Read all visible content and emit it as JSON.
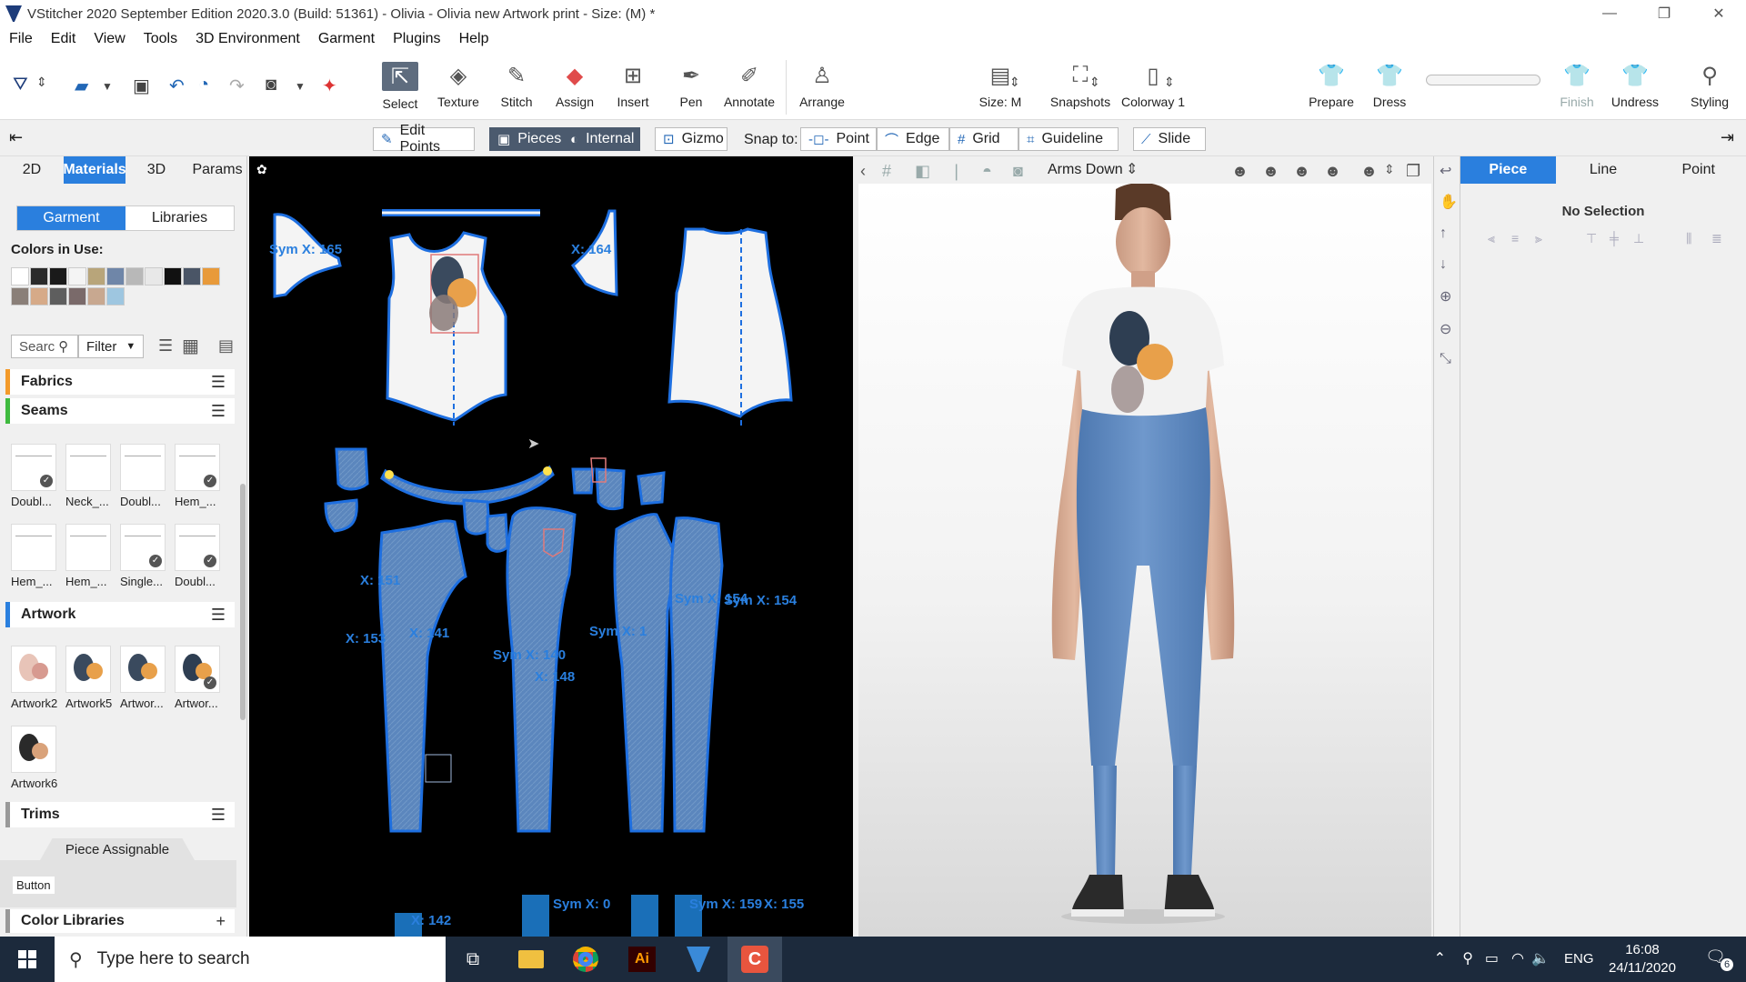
{
  "window": {
    "title": "VStitcher 2020 September Edition 2020.3.0 (Build: 51361) - Olivia - Olivia new Artwork print - Size: (M) *"
  },
  "menu": [
    "File",
    "Edit",
    "View",
    "Tools",
    "3D Environment",
    "Garment",
    "Plugins",
    "Help"
  ],
  "toolbar": {
    "select": "Select",
    "texture": "Texture",
    "stitch": "Stitch",
    "assign": "Assign",
    "insert": "Insert",
    "pen": "Pen",
    "annotate": "Annotate",
    "arrange": "Arrange",
    "size": "Size: M",
    "snapshots": "Snapshots",
    "colorway": "Colorway 1",
    "prepare": "Prepare",
    "dress": "Dress",
    "finish": "Finish",
    "undress": "Undress",
    "styling": "Styling"
  },
  "snapbar": {
    "edit_points": "Edit Points",
    "pieces": "Pieces",
    "internal": "Internal",
    "gizmo": "Gizmo",
    "snap_to": "Snap to:",
    "point": "Point",
    "edge": "Edge",
    "grid": "Grid",
    "guideline": "Guideline",
    "slide": "Slide"
  },
  "left_panel": {
    "tabs": [
      "2D",
      "Materials",
      "3D",
      "Params"
    ],
    "sub_tabs": [
      "Garment",
      "Libraries"
    ],
    "colors_in_use": "Colors in Use:",
    "swatches_row1": [
      "#ffffff",
      "#2a2a2a",
      "#1a1a1a",
      "#f4f4f4",
      "#b8a57a",
      "#6f86a8",
      "#b8b8b8",
      "#e8e8e8",
      "#111111",
      "#4a5566",
      "#e89a3a"
    ],
    "swatches_row2": [
      "#8a7f78",
      "#d6aa88",
      "#5e5e5e",
      "#7a6a6a",
      "#c8a890",
      "#9ec6e0"
    ],
    "search_placeholder": "Searc",
    "filter": "Filter",
    "fabrics": "Fabrics",
    "seams": "Seams",
    "seam_items": [
      "Doubl...",
      "Neck_...",
      "Doubl...",
      "Hem_...",
      "Hem_...",
      "Hem_...",
      "Single...",
      "Doubl..."
    ],
    "artwork": "Artwork",
    "artwork_items": [
      "Artwork2",
      "Artwork5",
      "Artwor...",
      "Artwor...",
      "Artwork6"
    ],
    "trims": "Trims",
    "piece_assignable": "Piece Assignable",
    "button": "Button",
    "color_libraries": "Color Libraries"
  },
  "view2d": {
    "measure_labels": [
      "Sym X: 165",
      "X: 164",
      "X: 151",
      "X: 153",
      "X: 141",
      "Sym X: 140",
      "X: 148",
      "Sym X: 1",
      "Sym X: 154",
      "Sym X: 154",
      "X: 142",
      "Sym X: 0",
      "Sym X: 159",
      "X: 155"
    ]
  },
  "view3d": {
    "pose": "Arms Down"
  },
  "right_panel": {
    "tabs": [
      "Piece",
      "Line",
      "Point"
    ],
    "no_selection": "No Selection"
  },
  "taskbar": {
    "search_placeholder": "Type here to search",
    "lang": "ENG",
    "time": "16:08",
    "date": "24/11/2020",
    "notifications": "6"
  },
  "colors": {
    "accent": "#2a7fde",
    "pattern_blue": "#1e6fe0",
    "denim": "#5b86bd",
    "taskbar": "#1c2a3c"
  }
}
